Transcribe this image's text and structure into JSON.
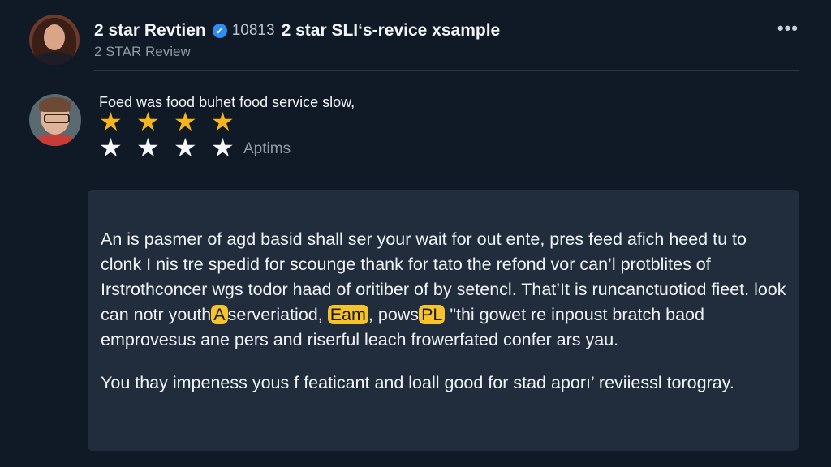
{
  "header": {
    "title_name": "2 star Revtien",
    "count": "10813",
    "title_example": "2 star SLIʻs-revice xsample",
    "subtitle": "2 STAR Review",
    "more_label": "•••"
  },
  "review": {
    "line": "Foed was food buhet food service slow,",
    "rating_yellow": 4,
    "rating_white": 4,
    "stars_label": "Aptims"
  },
  "body": {
    "para1_a": "An is pasmer of agd basid shall ser your wait for out ente, pres feed afich heed tu to clonk I nis tre spedid for scounge thank for tato the refond vor can’l protblites of Irstrothconcer wgs todor haad of oritiber of by setencl. That’It is runcanctuotiod fieet. look can notr youth",
    "hl1": "A",
    "para1_b": "serveriatiod,",
    "hl2": "Eam",
    "para1_c": ", pows",
    "hl3": "PL",
    "para1_d": "\"thi gowet re inpoust bratch baod emprovesus ane pers and riserful leach frowerfated confer ars yau.",
    "para2": "You thay impeness yous f featicant and loall good for stad aporı’ reviiessl torogray."
  },
  "colors": {
    "background": "#101a26",
    "card": "#212d3c",
    "star_yellow": "#f6b51d",
    "verified": "#2f8df2",
    "highlight": "#f6c32c"
  },
  "icons": {
    "verified": "verified-badge-icon",
    "more": "more-options-icon",
    "star": "star-icon"
  }
}
